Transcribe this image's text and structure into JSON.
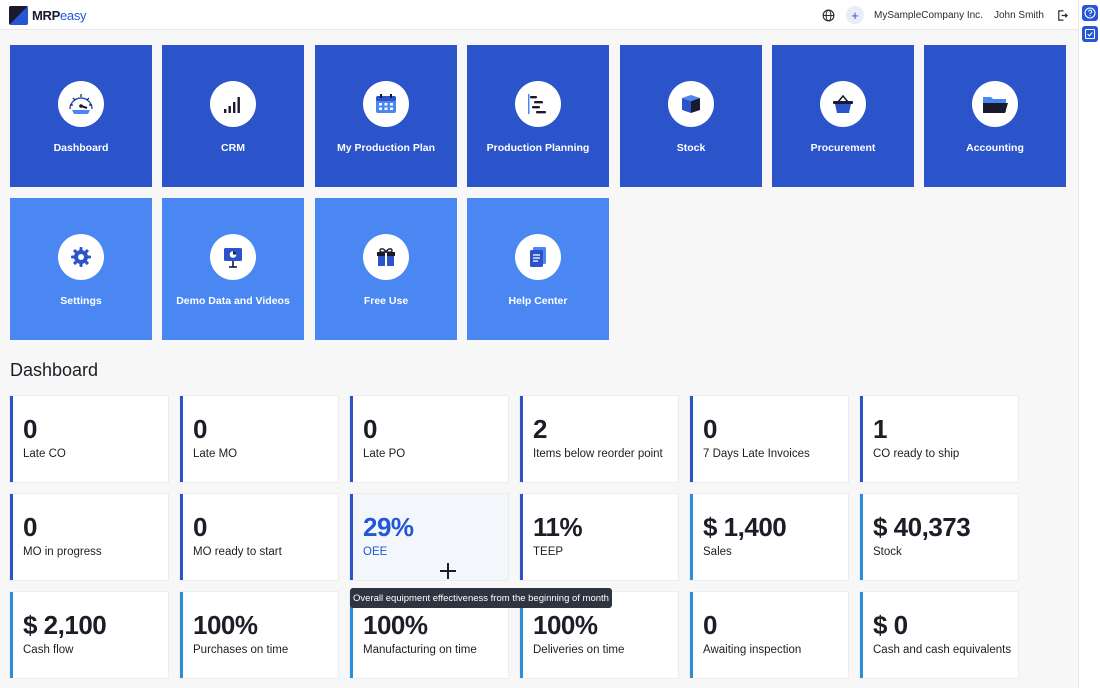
{
  "brand": {
    "strong": "MRP",
    "light": "easy"
  },
  "header": {
    "company": "MySampleCompany Inc.",
    "user": "John Smith"
  },
  "modules": [
    {
      "label": "Dashboard",
      "icon": "gauge-icon",
      "tone": "dark"
    },
    {
      "label": "CRM",
      "icon": "signal-bars-icon",
      "tone": "dark"
    },
    {
      "label": "My Production Plan",
      "icon": "calendar-icon",
      "tone": "dark"
    },
    {
      "label": "Production Planning",
      "icon": "gantt-icon",
      "tone": "dark"
    },
    {
      "label": "Stock",
      "icon": "box-icon",
      "tone": "dark"
    },
    {
      "label": "Procurement",
      "icon": "basket-icon",
      "tone": "dark"
    },
    {
      "label": "Accounting",
      "icon": "folder-icon",
      "tone": "dark"
    },
    {
      "label": "Settings",
      "icon": "gear-icon",
      "tone": "light"
    },
    {
      "label": "Demo Data and Videos",
      "icon": "presentation-icon",
      "tone": "light"
    },
    {
      "label": "Free Use",
      "icon": "gift-icon",
      "tone": "light"
    },
    {
      "label": "Help Center",
      "icon": "document-icon",
      "tone": "light"
    }
  ],
  "dashboard": {
    "title": "Dashboard",
    "kpis": [
      {
        "value": "0",
        "label": "Late CO"
      },
      {
        "value": "0",
        "label": "Late MO"
      },
      {
        "value": "0",
        "label": "Late PO"
      },
      {
        "value": "2",
        "label": "Items below reorder point"
      },
      {
        "value": "0",
        "label": "7 Days Late Invoices"
      },
      {
        "value": "1",
        "label": "CO ready to ship"
      },
      {
        "value": "0",
        "label": "MO in progress"
      },
      {
        "value": "0",
        "label": "MO ready to start"
      },
      {
        "value": "29%",
        "label": "OEE"
      },
      {
        "value": "11%",
        "label": "TEEP"
      },
      {
        "value": "$ 1,400",
        "label": "Sales"
      },
      {
        "value": "$ 40,373",
        "label": "Stock"
      },
      {
        "value": "$ 2,100",
        "label": "Cash flow"
      },
      {
        "value": "100%",
        "label": "Purchases on time"
      },
      {
        "value": "100%",
        "label": "Manufacturing on time"
      },
      {
        "value": "100%",
        "label": "Deliveries on time"
      },
      {
        "value": "0",
        "label": "Awaiting inspection"
      },
      {
        "value": "$ 0",
        "label": "Cash and cash equivalents"
      }
    ],
    "tooltip": "Overall equipment effectiveness from the beginning of month"
  },
  "colors": {
    "accent": "#2357d6",
    "tile_dark": "#2b54cb",
    "tile_light": "#4a87f2",
    "card_border_dark": "#2b54cb",
    "card_border_light": "#2a8fd8"
  }
}
